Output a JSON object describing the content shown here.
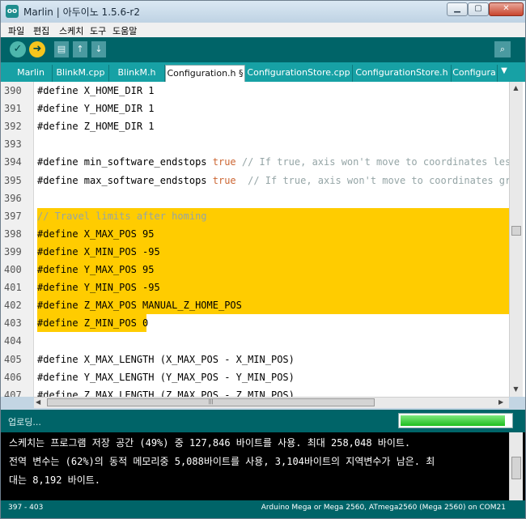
{
  "window": {
    "title": "Marlin | 아두이노 1.5.6-r2",
    "app_icon": "oo"
  },
  "menu": [
    "파일",
    "편집",
    "스케치",
    "도구",
    "도움말"
  ],
  "toolbar": {
    "verify_icon": "✓",
    "upload_icon": "➜",
    "new_icon": "▤",
    "open_icon": "↑",
    "save_icon": "↓",
    "serial_icon": "⌕"
  },
  "tabs": [
    "Marlin",
    "BlinkM.cpp",
    "BlinkM.h",
    "Configuration.h §",
    "ConfigurationStore.cpp",
    "ConfigurationStore.h",
    "Configura"
  ],
  "tab_more_icon": "▼",
  "editor": {
    "lines": [
      {
        "n": "390",
        "parts": [
          {
            "t": "#define X_HOME_DIR 1",
            "c": ""
          }
        ]
      },
      {
        "n": "391",
        "parts": [
          {
            "t": "#define Y_HOME_DIR 1",
            "c": ""
          }
        ]
      },
      {
        "n": "392",
        "parts": [
          {
            "t": "#define Z_HOME_DIR 1",
            "c": ""
          }
        ]
      },
      {
        "n": "393",
        "parts": []
      },
      {
        "n": "394",
        "parts": [
          {
            "t": "#define min_software_endstops ",
            "c": ""
          },
          {
            "t": "true",
            "c": "kw"
          },
          {
            "t": " // If true, axis won't move to coordinates less",
            "c": "cm"
          }
        ]
      },
      {
        "n": "395",
        "parts": [
          {
            "t": "#define max_software_endstops ",
            "c": ""
          },
          {
            "t": "true",
            "c": "kw"
          },
          {
            "t": "  // If true, axis won't move to coordinates grea",
            "c": "cm"
          }
        ]
      },
      {
        "n": "396",
        "parts": []
      },
      {
        "n": "397",
        "parts": [
          {
            "t": "// Travel limits after homing",
            "c": "cm"
          }
        ]
      },
      {
        "n": "398",
        "parts": [
          {
            "t": "#define X_MAX_POS 95",
            "c": ""
          }
        ]
      },
      {
        "n": "399",
        "parts": [
          {
            "t": "#define X_MIN_POS -95",
            "c": ""
          }
        ]
      },
      {
        "n": "400",
        "parts": [
          {
            "t": "#define Y_MAX_POS 95",
            "c": ""
          }
        ]
      },
      {
        "n": "401",
        "parts": [
          {
            "t": "#define Y_MIN_POS -95",
            "c": ""
          }
        ]
      },
      {
        "n": "402",
        "parts": [
          {
            "t": "#define Z_MAX_POS MANUAL_Z_HOME_POS",
            "c": ""
          }
        ]
      },
      {
        "n": "403",
        "parts": [
          {
            "t": "#define Z_MIN_POS 0",
            "c": ""
          }
        ]
      },
      {
        "n": "404",
        "parts": []
      },
      {
        "n": "405",
        "parts": [
          {
            "t": "#define X_MAX_LENGTH (X_MAX_POS - X_MIN_POS)",
            "c": ""
          }
        ]
      },
      {
        "n": "406",
        "parts": [
          {
            "t": "#define Y_MAX_LENGTH (Y_MAX_POS - Y_MIN_POS)",
            "c": ""
          }
        ]
      },
      {
        "n": "407",
        "parts": [
          {
            "t": "#define Z_MAX_LENGTH (Z_MAX_POS - Z_MIN_POS)",
            "c": ""
          }
        ]
      }
    ]
  },
  "scroll": {
    "up_icon": "▲",
    "down_icon": "▼",
    "left_icon": "◀",
    "right_icon": "▶",
    "grip": "|||"
  },
  "status": {
    "text": "업로딩...",
    "progress_percent": 95
  },
  "console": {
    "lines": [
      "스케치는 프로그램 저장 공간 (49%) 중 127,846 바이트를 사용. 최대 258,048 바이트.",
      "전역 변수는 (62%)의 동적 메모리중 5,088바이트를 사용, 3,104바이트의 지역변수가 남은. 최",
      "대는 8,192 바이트."
    ]
  },
  "footer": {
    "position": "397 - 403",
    "board": "Arduino Mega or Mega 2560, ATmega2560 (Mega 2560) on COM21"
  }
}
